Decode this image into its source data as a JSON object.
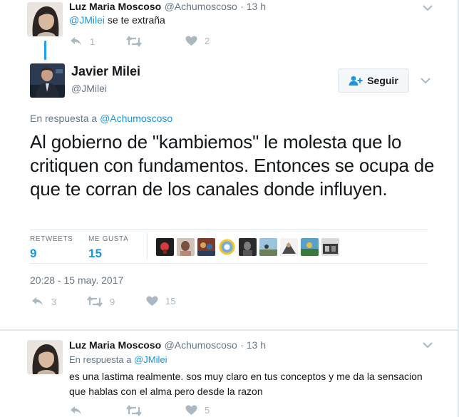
{
  "tweet_reply_top": {
    "author_name": "Luz Maria Moscoso",
    "author_handle": "@Achumoscoso",
    "time": "· 13 h",
    "mention": "@JMilei",
    "text": " se te extraña",
    "replies": "1",
    "retweets": "",
    "likes": "2"
  },
  "main_tweet": {
    "author_name": "Javier Milei",
    "author_handle": "@JMilei",
    "follow_label": "Seguir",
    "reply_to_label": "En respuesta a ",
    "reply_to_handle": "@Achumoscoso",
    "text": "Al gobierno de \"kambiemos\" le molesta que lo critiquen con fundamentos. Entonces se ocupa de que te corran de los canales donde influyen.",
    "stats": {
      "retweets_label": "RETWEETS",
      "retweets_value": "9",
      "likes_label": "ME GUSTA",
      "likes_value": "15"
    },
    "timestamp": "20:28 - 15 may. 2017",
    "actions": {
      "replies": "3",
      "retweets": "9",
      "likes": "15"
    }
  },
  "tweet_reply_bottom": {
    "author_name": "Luz Maria Moscoso",
    "author_handle": "@Achumoscoso",
    "time": "· 13 h",
    "reply_to_label": "En respuesta a ",
    "reply_to_handle": "@JMilei",
    "text": "es una lastima realmente. sos muy claro en tus conceptos y me da la sensacion que hablas con el alma pero desde la razon",
    "replies": "",
    "retweets": "",
    "likes": "5"
  },
  "icons": {
    "reply": "reply-arrow-icon",
    "retweet": "retweet-icon",
    "like": "heart-icon",
    "more": "chevron-down-icon",
    "follow": "add-user-icon"
  },
  "colors": {
    "accent": "#1b95e0",
    "thread_line": "#1da1f2",
    "muted": "#657786",
    "action_gray": "#aab8c2",
    "border": "#e1e8ed"
  }
}
